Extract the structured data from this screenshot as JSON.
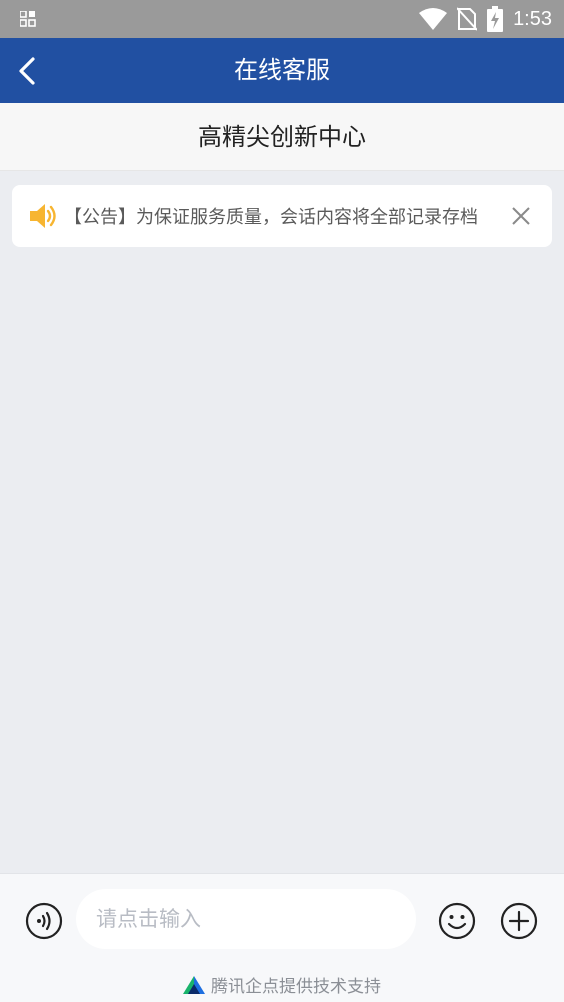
{
  "status_bar": {
    "time": "1:53"
  },
  "nav": {
    "title": "在线客服"
  },
  "subheader": {
    "title": "高精尖创新中心"
  },
  "notice": {
    "text": "【公告】为保证服务质量，会话内容将全部记录存档"
  },
  "composer": {
    "placeholder": "请点击输入"
  },
  "footer": {
    "powered_by": "腾讯企点提供技术支持"
  },
  "colors": {
    "nav": "#2150a2",
    "accent_speaker": "#f7b531",
    "background": "#ebedf1"
  }
}
